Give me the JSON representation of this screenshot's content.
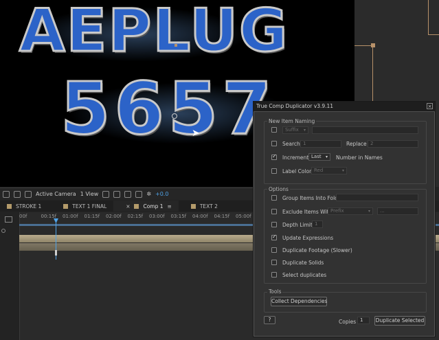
{
  "viewer": {
    "logo_line1": "AEPLUG",
    "logo_line2": "5657"
  },
  "toolbar": {
    "camera": "Active Camera",
    "view": "1 View",
    "exposure": "+0.0"
  },
  "tabs": [
    {
      "label": "STROKE 1"
    },
    {
      "label": "TEXT 1 FINAL"
    },
    {
      "label": "Comp 1"
    },
    {
      "label": "TEXT 2"
    }
  ],
  "timeline": {
    "ticks": [
      "00f",
      "00:15f",
      "01:00f",
      "01:15f",
      "02:00f",
      "02:15f",
      "03:00f",
      "03:15f",
      "04:00f",
      "04:15f",
      "05:00f"
    ]
  },
  "dialog": {
    "title": "True Comp Duplicator v3.9.11",
    "close": "×",
    "naming": {
      "group_label": "New Item Naming",
      "suffix_select": "Suffix",
      "search_label": "Search",
      "search_value": "1",
      "replace_label": "Replace",
      "replace_value": "2",
      "increment_label": "Increment",
      "increment_select": "Last",
      "increment_suffix": "Number in Names",
      "label_color_label": "Label Color",
      "label_color_select": "Red"
    },
    "options": {
      "group_label": "Options",
      "group_items": "Group Items Into Folder",
      "exclude_items": "Exclude Items With",
      "exclude_select": "Prefix",
      "exclude_browse": "...",
      "depth_limit": "Depth Limit",
      "depth_value": "1",
      "update_expressions": "Update Expressions",
      "duplicate_footage": "Duplicate Footage (Slower)",
      "duplicate_solids": "Duplicate Solids",
      "select_duplicates": "Select duplicates"
    },
    "tools": {
      "group_label": "Tools",
      "collect_button": "Collect Dependencies"
    },
    "footer": {
      "help_button": "?",
      "copies_label": "Copies",
      "copies_value": "1",
      "duplicate_button": "Duplicate Selected"
    }
  }
}
